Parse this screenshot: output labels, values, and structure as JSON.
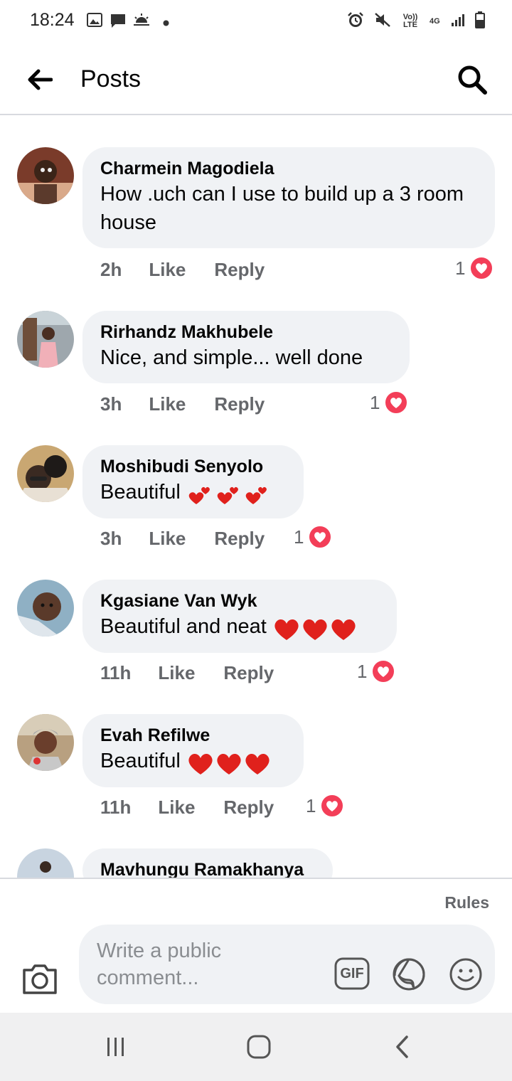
{
  "status_bar": {
    "time": "18:24",
    "left_icons": [
      "image-icon",
      "message-icon",
      "weather-icon",
      "dot-icon"
    ],
    "right_icons": [
      "alarm-icon",
      "mute-icon",
      "volte-icon",
      "4g-icon",
      "signal-icon",
      "battery-icon"
    ],
    "volte_label": "Vo)) LTE",
    "network_label": "4G"
  },
  "header": {
    "title": "Posts"
  },
  "comments": [
    {
      "author": "Charmein Magodiela",
      "text": "How .uch can I use to build up a 3 room house",
      "time": "2h",
      "reaction_count": "1"
    },
    {
      "author": "Rirhandz Makhubele",
      "text": "Nice, and simple... well done",
      "time": "3h",
      "reaction_count": "1"
    },
    {
      "author": "Moshibudi Senyolo",
      "text": "Beautiful",
      "time": "3h",
      "reaction_count": "1"
    },
    {
      "author": "Kgasiane Van Wyk",
      "text": "Beautiful and neat",
      "time": "11h",
      "reaction_count": "1"
    },
    {
      "author": "Evah Refilwe",
      "text": "Beautiful",
      "time": "11h",
      "reaction_count": "1"
    },
    {
      "author": "Mavhungu Ramakhanya"
    }
  ],
  "actions": {
    "like_label": "Like",
    "reply_label": "Reply"
  },
  "composer": {
    "rules_label": "Rules",
    "placeholder": "Write a public comment...",
    "gif_label": "GIF"
  },
  "colors": {
    "bubble": "#f0f2f5",
    "meta_text": "#65676b",
    "heart_red": "#f33e58",
    "emoji_heart": "#e0211c"
  }
}
